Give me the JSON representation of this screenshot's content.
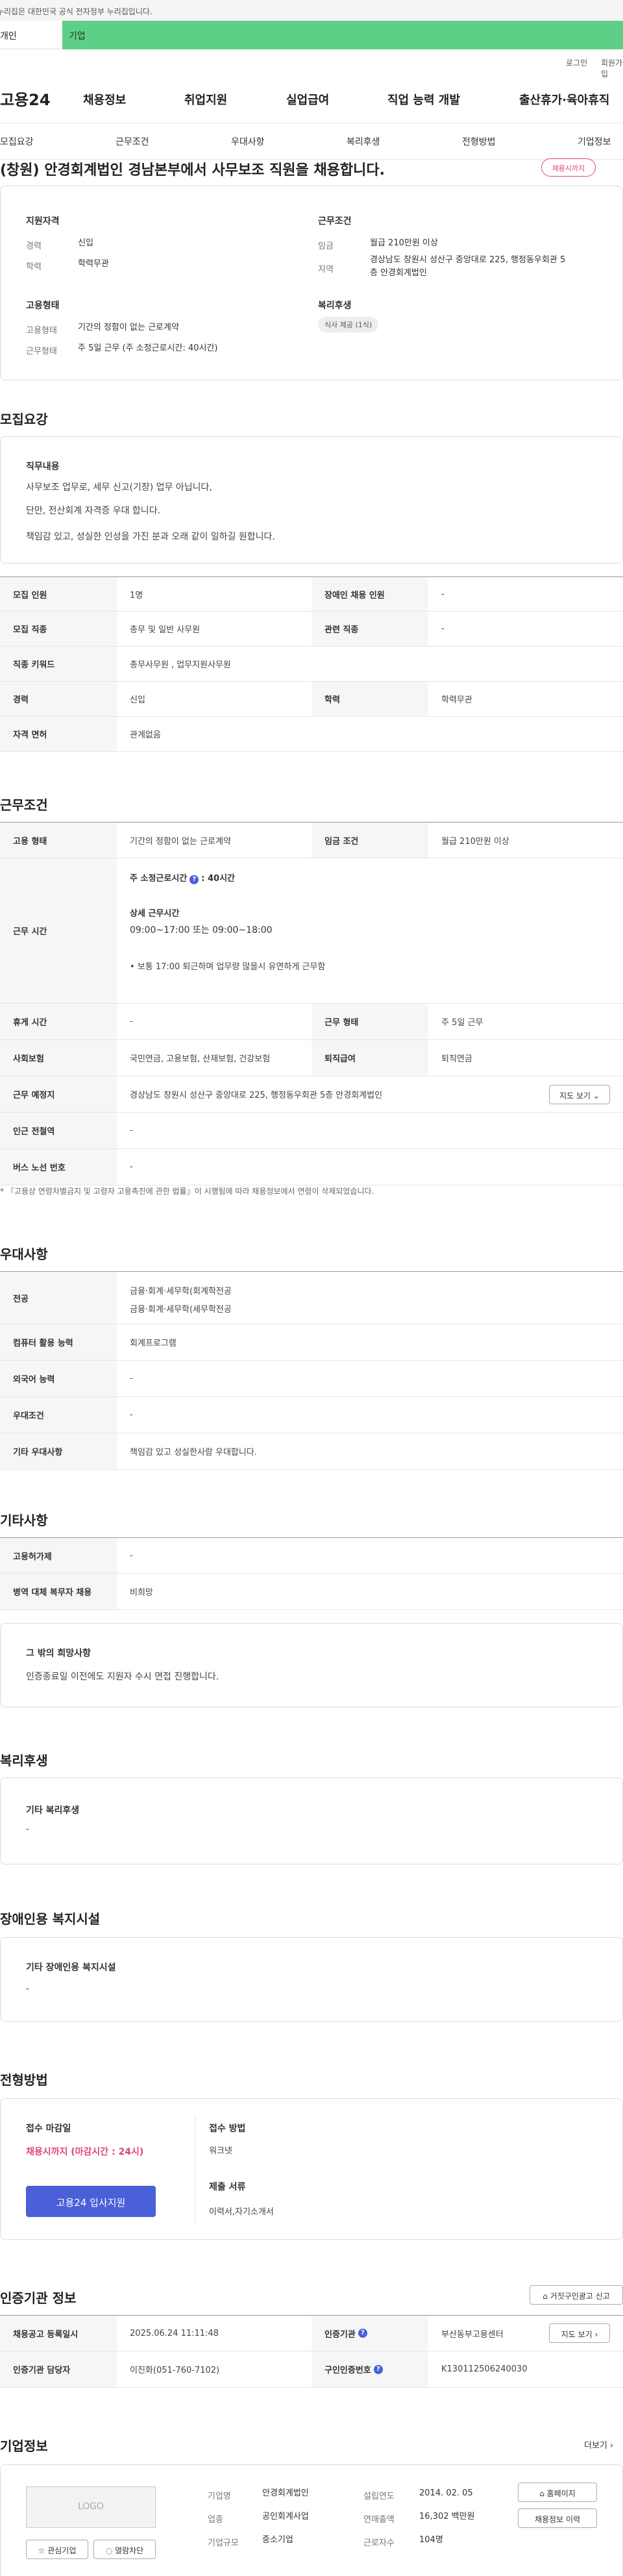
{
  "gov_banner": "이 누리집은 대한민국 공식 전자정부 누리집입니다.",
  "tabs": {
    "person": "개인",
    "company": "기업"
  },
  "util": {
    "login": "로그인",
    "signup": "회원가입"
  },
  "gnb": {
    "logo": "고용24",
    "items": [
      "채용정보",
      "취업지원",
      "실업급여",
      "직업 능력 개발",
      "출산휴가·육아휴직"
    ]
  },
  "subnav": [
    "모집요강",
    "근무조건",
    "우대사항",
    "복리후생",
    "전형방법",
    "기업정보"
  ],
  "job": {
    "title": "(창원) 안경회계법인 경남본부에서 사무보조 직원을 채용합니다.",
    "deadline_badge": "채용시까지",
    "summary": {
      "qualification_h": "지원자격",
      "career_k": "경력",
      "career_v": "신입",
      "edu_k": "학력",
      "edu_v": "학력무관",
      "employ_h": "고용형태",
      "etype_k": "고용형태",
      "etype_v": "기간의 정함이 없는 근로계약",
      "wtype_k": "근무형태",
      "wtype_v": "주 5일 근무 (주 소정근로시간: 40시간)",
      "cond_h": "근무조건",
      "wage_k": "임금",
      "wage_v": "월급 210만원 이상",
      "region_k": "지역",
      "region_v1": "경상남도 창원시 성산구 중앙대로 225, 행정동우회관 5",
      "region_v2": "층 안경회계법인",
      "welfare_h": "복리후생",
      "welfare_pill": "식사 제공 (1식)"
    }
  },
  "recruit": {
    "title": "모집요강",
    "duty_h": "직무내용",
    "duty_lines": [
      "사무보조 업무로, 세무 신고(기장) 업무 아닙니다,",
      "단만, 전산회계 자격증 우대 합니다.",
      "책임감 있고, 성실한 인성을 가진 분과 오래 같이 일하길 원합니다."
    ],
    "table": [
      [
        "모집 인원",
        "1명",
        "장애인 채용 인원",
        "-"
      ],
      [
        "모집 직종",
        "총무 및 일반 사무원",
        "관련 직종",
        "-"
      ],
      [
        "직종 키워드",
        "총무사무원 , 업무지원사무원",
        "",
        ""
      ],
      [
        "경력",
        "신입",
        "학력",
        "학력무관"
      ],
      [
        "자격 면허",
        "관계없음",
        "",
        ""
      ]
    ]
  },
  "work": {
    "title": "근무조건",
    "etype_k": "고용 형태",
    "etype_v": "기간의 정함이 없는 근로계약",
    "wage_k": "임금 조건",
    "wage_v": "월급 210만원 이상",
    "hours_k": "근무 시간",
    "hours_week": "주 소정근로시간",
    "hours_week_val": ": 40시간",
    "hours_detail_h": "상세 근무시간",
    "hours_detail": "09:00~17:00 또는 09:00~18:00",
    "hours_note": "• 보통 17:00 퇴근하며 업무량 많을시 유연하게 근무함",
    "rest_k": "휴게 시간",
    "rest_v": "-",
    "wform_k": "근무 형태",
    "wform_v": "주 5일 근무",
    "ins_k": "사회보험",
    "ins_v": "국민연금, 고용보험, 산재보험, 건강보험",
    "retire_k": "퇴직급여",
    "retire_v": "퇴직연금",
    "place_k": "근무 예정지",
    "place_v": "경상남도 창원시 성산구 중앙대로 225, 행정동우회관 5층 안경회계법인",
    "map_btn": "지도 보기 ⌄",
    "subway_k": "인근 전철역",
    "subway_v": "-",
    "bus_k": "버스 노선 번호",
    "bus_v": "-",
    "note": "* 『고용상 연령차별금지 및 고령자 고용촉진에 관한 법률』이 시행됨에 따라 채용정보에서 연령이 삭제되었습니다."
  },
  "pref": {
    "title": "우대사항",
    "major_k": "전공",
    "major_v1": "금융·회계·세무학(회계학전공",
    "major_v2": "금융·회계·세무학(세무학전공",
    "pc_k": "컴퓨터 활용 능력",
    "pc_v": "회계프로그램",
    "lang_k": "외국어 능력",
    "lang_v": "-",
    "cond_k": "우대조건",
    "cond_v": "-",
    "etc_k": "기타 우대사항",
    "etc_v": "책임감 있고 성실한사람 우대합니다."
  },
  "etc": {
    "title": "기타사항",
    "loan_k": "고용허가제",
    "loan_v": "-",
    "mil_k": "병역 대체 복무자 채용",
    "mil_v": "비희망",
    "other_h": "그 밖의 희망사항",
    "other_v": "인증종료일 이전에도 지원자 수시 면접 진행합니다."
  },
  "welfare": {
    "title": "복리후생",
    "h": "기타 복리후생",
    "v": "-"
  },
  "disab": {
    "title": "장애인용 복지시설",
    "h": "기타 장애인용 복지시설",
    "v": "-"
  },
  "process": {
    "title": "전형방법",
    "deadline_h": "접수 마감일",
    "deadline_v": "채용시까지 (마감시간 : 24시)",
    "apply_btn": "고용24 입사지원",
    "method_h": "접수 방법",
    "method_v": "워크넷",
    "docs_h": "제출 서류",
    "docs_v": "이력서,자기소개서"
  },
  "agency": {
    "title": "인증기관 정보",
    "report_btn": "거짓구인광고 신고",
    "reg_k": "채용공고 등록일시",
    "reg_v": "2025.06.24 11:11:48",
    "org_k": "인증기관",
    "org_v": "부산동부고용센터",
    "detail_btn": "지도 보기 ›",
    "mgr_k": "인증기관 담당자",
    "mgr_v": "이진화(051-760-7102)",
    "no_k": "구인인증번호",
    "no_v": "K130112506240030"
  },
  "company": {
    "title": "기업정보",
    "more": "더보기 ›",
    "logo": "LOGO",
    "name_k": "기업명",
    "name_v": "안경회계법인",
    "ind_k": "업종",
    "ind_v": "공인회계사업",
    "size_k": "기업규모",
    "size_v": "중소기업",
    "est_k": "설립연도",
    "est_v": "2014. 02. 05",
    "sales_k": "연매출액",
    "sales_v": "16,302 백만원",
    "emp_k": "근로자수",
    "emp_v": "104명",
    "home_btn": "홈페이지",
    "history_btn": "채용정보 이력",
    "fav_btn": "☆ 관심기업",
    "block_btn": "◌ 열람차단"
  }
}
